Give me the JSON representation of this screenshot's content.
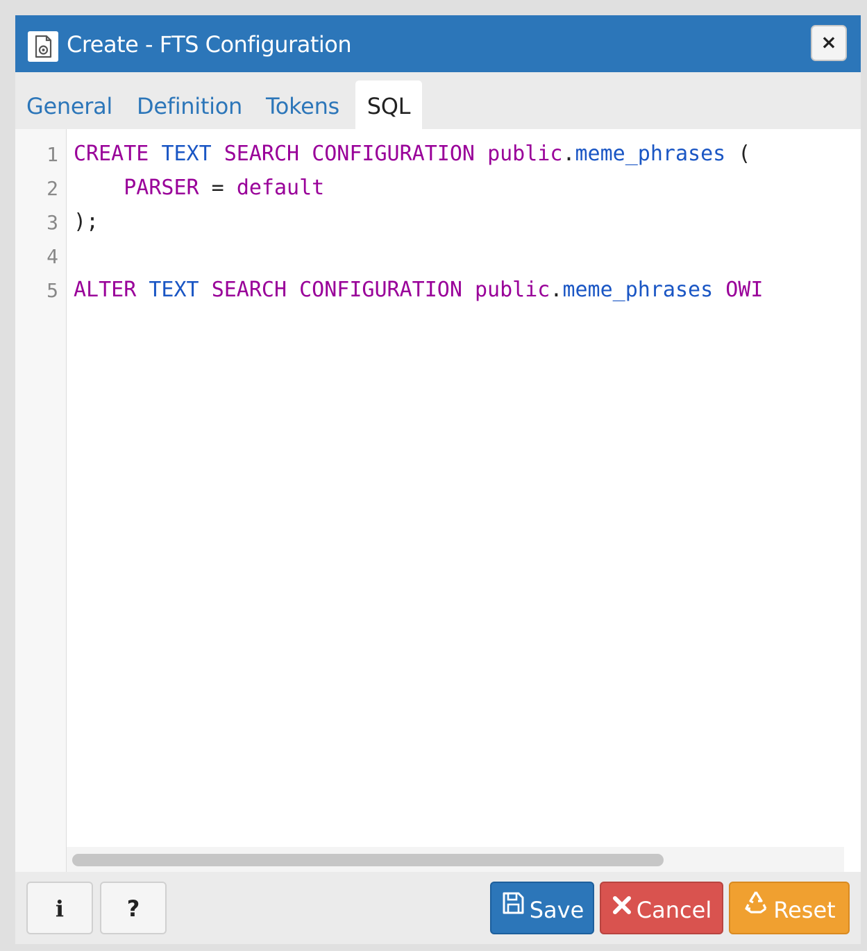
{
  "dialog": {
    "title": "Create - FTS Configuration",
    "close_label": "×"
  },
  "tabs": [
    {
      "label": "General"
    },
    {
      "label": "Definition"
    },
    {
      "label": "Tokens"
    },
    {
      "label": "SQL"
    }
  ],
  "active_tab": "SQL",
  "editor": {
    "line_numbers": [
      "1",
      "2",
      "3",
      "4",
      "5"
    ],
    "lines": [
      {
        "tokens": [
          {
            "text": "CREATE",
            "type": "kw"
          },
          {
            "text": " ",
            "type": "plain"
          },
          {
            "text": "TEXT",
            "type": "var"
          },
          {
            "text": " ",
            "type": "plain"
          },
          {
            "text": "SEARCH",
            "type": "kw"
          },
          {
            "text": " ",
            "type": "plain"
          },
          {
            "text": "CONFIGURATION",
            "type": "kw"
          },
          {
            "text": " ",
            "type": "plain"
          },
          {
            "text": "public",
            "type": "kw"
          },
          {
            "text": ".",
            "type": "plain"
          },
          {
            "text": "meme_phrases",
            "type": "var"
          },
          {
            "text": " (",
            "type": "plain"
          }
        ]
      },
      {
        "tokens": [
          {
            "text": "    ",
            "type": "plain"
          },
          {
            "text": "PARSER",
            "type": "kw"
          },
          {
            "text": " = ",
            "type": "plain"
          },
          {
            "text": "default",
            "type": "kw"
          }
        ]
      },
      {
        "tokens": [
          {
            "text": ");",
            "type": "plain"
          }
        ]
      },
      {
        "tokens": []
      },
      {
        "tokens": [
          {
            "text": "ALTER",
            "type": "kw"
          },
          {
            "text": " ",
            "type": "plain"
          },
          {
            "text": "TEXT",
            "type": "var"
          },
          {
            "text": " ",
            "type": "plain"
          },
          {
            "text": "SEARCH",
            "type": "kw"
          },
          {
            "text": " ",
            "type": "plain"
          },
          {
            "text": "CONFIGURATION",
            "type": "kw"
          },
          {
            "text": " ",
            "type": "plain"
          },
          {
            "text": "public",
            "type": "kw"
          },
          {
            "text": ".",
            "type": "plain"
          },
          {
            "text": "meme_phrases",
            "type": "var"
          },
          {
            "text": " ",
            "type": "plain"
          },
          {
            "text": "OWI",
            "type": "kw"
          }
        ]
      }
    ]
  },
  "footer": {
    "info_label": "i",
    "help_label": "?",
    "save_label": "Save",
    "cancel_label": "Cancel",
    "reset_label": "Reset"
  },
  "colors": {
    "titlebar": "#2c76b9",
    "keyword": "#990099",
    "variable": "#1a56c4",
    "save": "#2c76b9",
    "cancel": "#d9534f",
    "reset": "#f0a030"
  },
  "icons": {
    "title": "document-gear-icon",
    "close": "close-icon",
    "save": "floppy-disk-icon",
    "cancel": "x-icon",
    "reset": "recycle-icon"
  }
}
